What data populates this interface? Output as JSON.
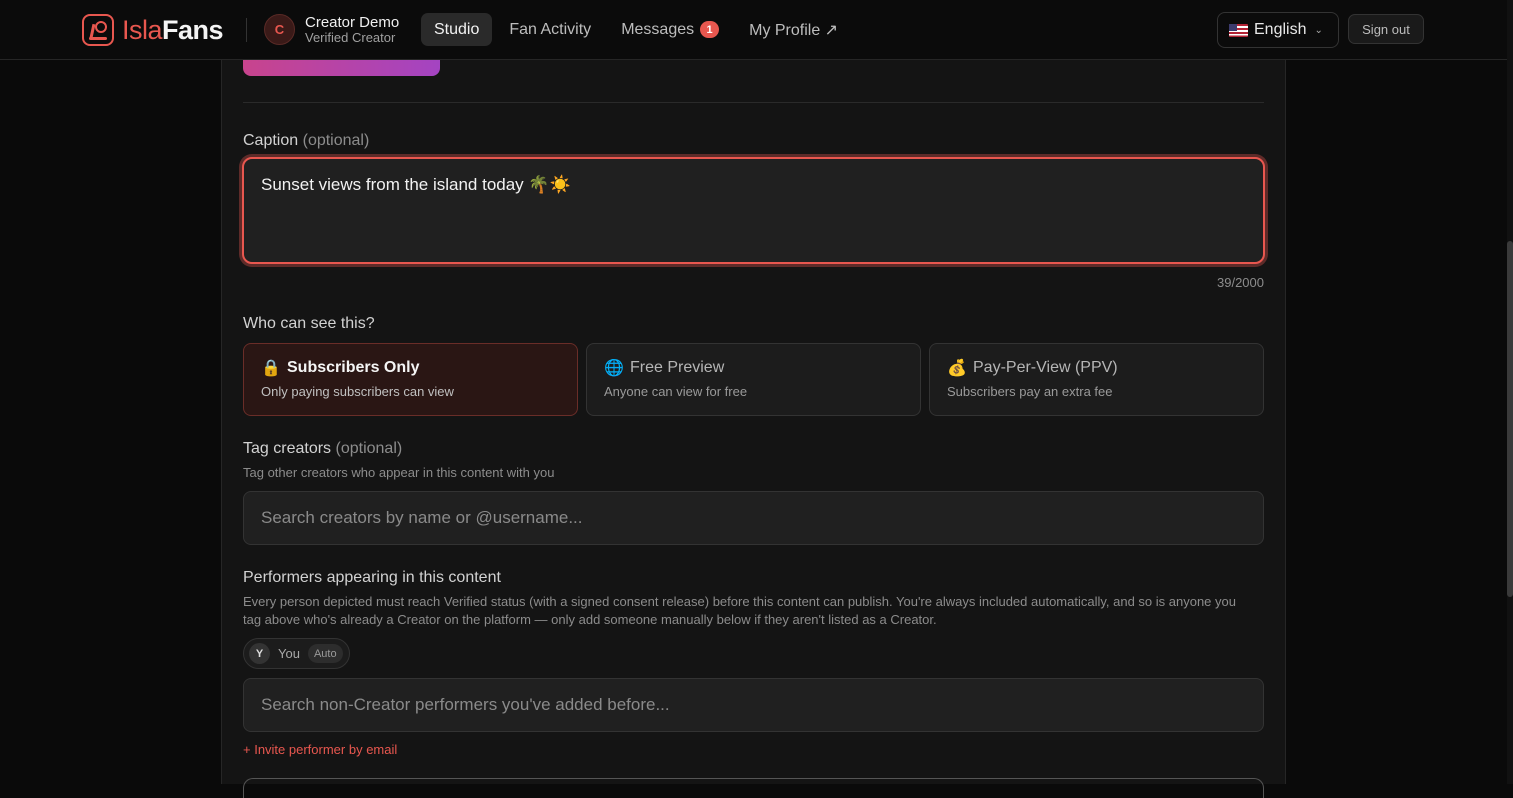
{
  "brand": {
    "name_part1": "Isla",
    "name_part2": "Fans"
  },
  "user": {
    "initial": "C",
    "name": "Creator Demo",
    "role": "Verified Creator"
  },
  "nav": {
    "studio": "Studio",
    "fan_activity": "Fan Activity",
    "messages": "Messages",
    "messages_badge": "1",
    "profile": "My Profile ↗"
  },
  "language": {
    "selected": "English"
  },
  "sign_out": "Sign out",
  "caption": {
    "label": "Caption",
    "optional": "(optional)",
    "value": "Sunset views from the island today 🌴☀️",
    "counter": "39/2000"
  },
  "visibility": {
    "label": "Who can see this?",
    "options": [
      {
        "icon": "🔒",
        "icon_name": "lock-icon",
        "title": "Subscribers Only",
        "desc": "Only paying subscribers can view",
        "selected": true
      },
      {
        "icon": "🌐",
        "icon_name": "globe-icon",
        "title": "Free Preview",
        "desc": "Anyone can view for free",
        "selected": false
      },
      {
        "icon": "💰",
        "icon_name": "money-bag-icon",
        "title": "Pay-Per-View (PPV)",
        "desc": "Subscribers pay an extra fee",
        "selected": false
      }
    ]
  },
  "tag_creators": {
    "label": "Tag creators",
    "optional": "(optional)",
    "help": "Tag other creators who appear in this content with you",
    "placeholder": "Search creators by name or @username..."
  },
  "performers": {
    "label": "Performers appearing in this content",
    "help": "Every person depicted must reach Verified status (with a signed consent release) before this content can publish. You're always included automatically, and so is anyone you tag above who's already a Creator on the platform — only add someone manually below if they aren't listed as a Creator.",
    "chip": {
      "initial": "Y",
      "name": "You",
      "tag": "Auto"
    },
    "placeholder": "Search non-Creator performers you've added before...",
    "invite": "+ Invite performer by email"
  },
  "colors": {
    "accent": "#e8574f",
    "background": "#0a0a0a",
    "panel": "#141414"
  }
}
